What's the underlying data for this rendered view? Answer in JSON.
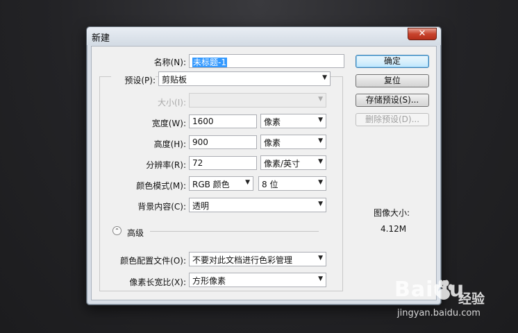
{
  "dialog": {
    "title": "新建",
    "close_glyph": "✕"
  },
  "form": {
    "name_label": "名称(N):",
    "name_value": "未标题-1",
    "preset_label": "预设(P):",
    "preset_value": "剪贴板",
    "size_label": "大小(I):",
    "size_value": "",
    "width_label": "宽度(W):",
    "width_value": "1600",
    "width_unit": "像素",
    "height_label": "高度(H):",
    "height_value": "900",
    "height_unit": "像素",
    "resolution_label": "分辨率(R):",
    "resolution_value": "72",
    "resolution_unit": "像素/英寸",
    "color_mode_label": "颜色模式(M):",
    "color_mode_value": "RGB 颜色",
    "bit_depth_value": "8 位",
    "background_label": "背景内容(C):",
    "background_value": "透明",
    "advanced_label": "高级",
    "advanced_icon": "chevron-up-circle-icon",
    "color_profile_label": "颜色配置文件(O):",
    "color_profile_value": "不要对此文档进行色彩管理",
    "pixel_aspect_label": "像素长宽比(X):",
    "pixel_aspect_value": "方形像素"
  },
  "buttons": {
    "ok": "确定",
    "reset": "复位",
    "save_preset": "存储预设(S)...",
    "delete_preset": "删除预设(D)..."
  },
  "image_size": {
    "label": "图像大小:",
    "value": "4.12M"
  },
  "watermark": {
    "brand": "Baidu",
    "service": "经验",
    "url": "jingyan.baidu.com"
  },
  "colors": {
    "selection": "#3399ff",
    "dialog_frame": "#d9dfe7",
    "close_button": "#c7432d"
  }
}
